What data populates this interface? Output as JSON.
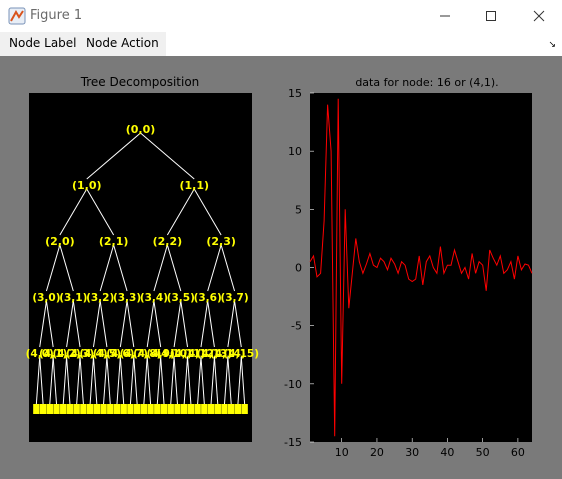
{
  "window": {
    "title": "Figure 1",
    "icon": "matlab-icon",
    "controls": {
      "minimize": "minimize-icon",
      "maximize": "maximize-icon",
      "close": "close-icon"
    }
  },
  "menu": {
    "items": [
      "Node Label",
      "Node Action"
    ]
  },
  "tree_panel": {
    "title": "Tree Decomposition",
    "level0": [
      "(0,0)"
    ],
    "level1": [
      "(1,0)",
      "(1,1)"
    ],
    "level2": [
      "(2,0)",
      "(2,1)",
      "(2,2)",
      "(2,3)"
    ],
    "level3": [
      "(3,0)",
      "(3,1)",
      "(3,2)",
      "(3,3)",
      "(3,4)",
      "(3,5)",
      "(3,6)",
      "(3,7)"
    ],
    "level4": [
      "(4,0)",
      "(4,1)",
      "(4,2)",
      "(4,3)",
      "(4,4)",
      "(4,5)",
      "(4,6)",
      "(4,7)",
      "(4,8)",
      "(4,9)",
      "(4,10)",
      "(4,11)",
      "(4,12)",
      "(4,13)",
      "(4,14)",
      "(4,15)"
    ],
    "label_color": "#ffff00",
    "line_color": "#ffffff",
    "background": "#000000"
  },
  "chart_data": {
    "type": "line",
    "title": "data for node: 16 or (4,1).",
    "xlabel": "",
    "ylabel": "",
    "xlim": [
      1,
      64
    ],
    "ylim": [
      -15,
      15
    ],
    "xticks": [
      10,
      20,
      30,
      40,
      50,
      60
    ],
    "yticks": [
      15,
      10,
      5,
      0,
      -5,
      -10,
      -15
    ],
    "grid": false,
    "series": [
      {
        "color": "#ff0000",
        "x": [
          1,
          2,
          3,
          4,
          5,
          6,
          7,
          8,
          9,
          10,
          11,
          12,
          13,
          14,
          15,
          16,
          17,
          18,
          19,
          20,
          21,
          22,
          23,
          24,
          25,
          26,
          27,
          28,
          29,
          30,
          31,
          32,
          33,
          34,
          35,
          36,
          37,
          38,
          39,
          40,
          41,
          42,
          43,
          44,
          45,
          46,
          47,
          48,
          49,
          50,
          51,
          52,
          53,
          54,
          55,
          56,
          57,
          58,
          59,
          60,
          61,
          62,
          63,
          64
        ],
        "y": [
          0.5,
          1.0,
          -0.8,
          -0.5,
          4.0,
          14.0,
          10.0,
          -14.5,
          14.5,
          -10.0,
          5.0,
          -3.5,
          -0.5,
          2.5,
          0.5,
          -0.5,
          0.3,
          1.2,
          0.2,
          0.0,
          0.8,
          0.5,
          -0.2,
          0.8,
          0.3,
          -0.5,
          0.5,
          0.2,
          -1.0,
          -1.2,
          -1.0,
          1.0,
          -1.5,
          0.5,
          1.0,
          0.0,
          -0.5,
          1.8,
          -0.5,
          0.2,
          0.2,
          1.5,
          0.5,
          -0.5,
          0.0,
          -1.0,
          1.2,
          -0.5,
          0.5,
          0.2,
          -2.0,
          1.5,
          0.8,
          0.2,
          1.0,
          -0.5,
          -0.2,
          0.5,
          -1.0,
          1.0,
          -0.2,
          0.3,
          0.2,
          -0.5
        ]
      }
    ]
  }
}
